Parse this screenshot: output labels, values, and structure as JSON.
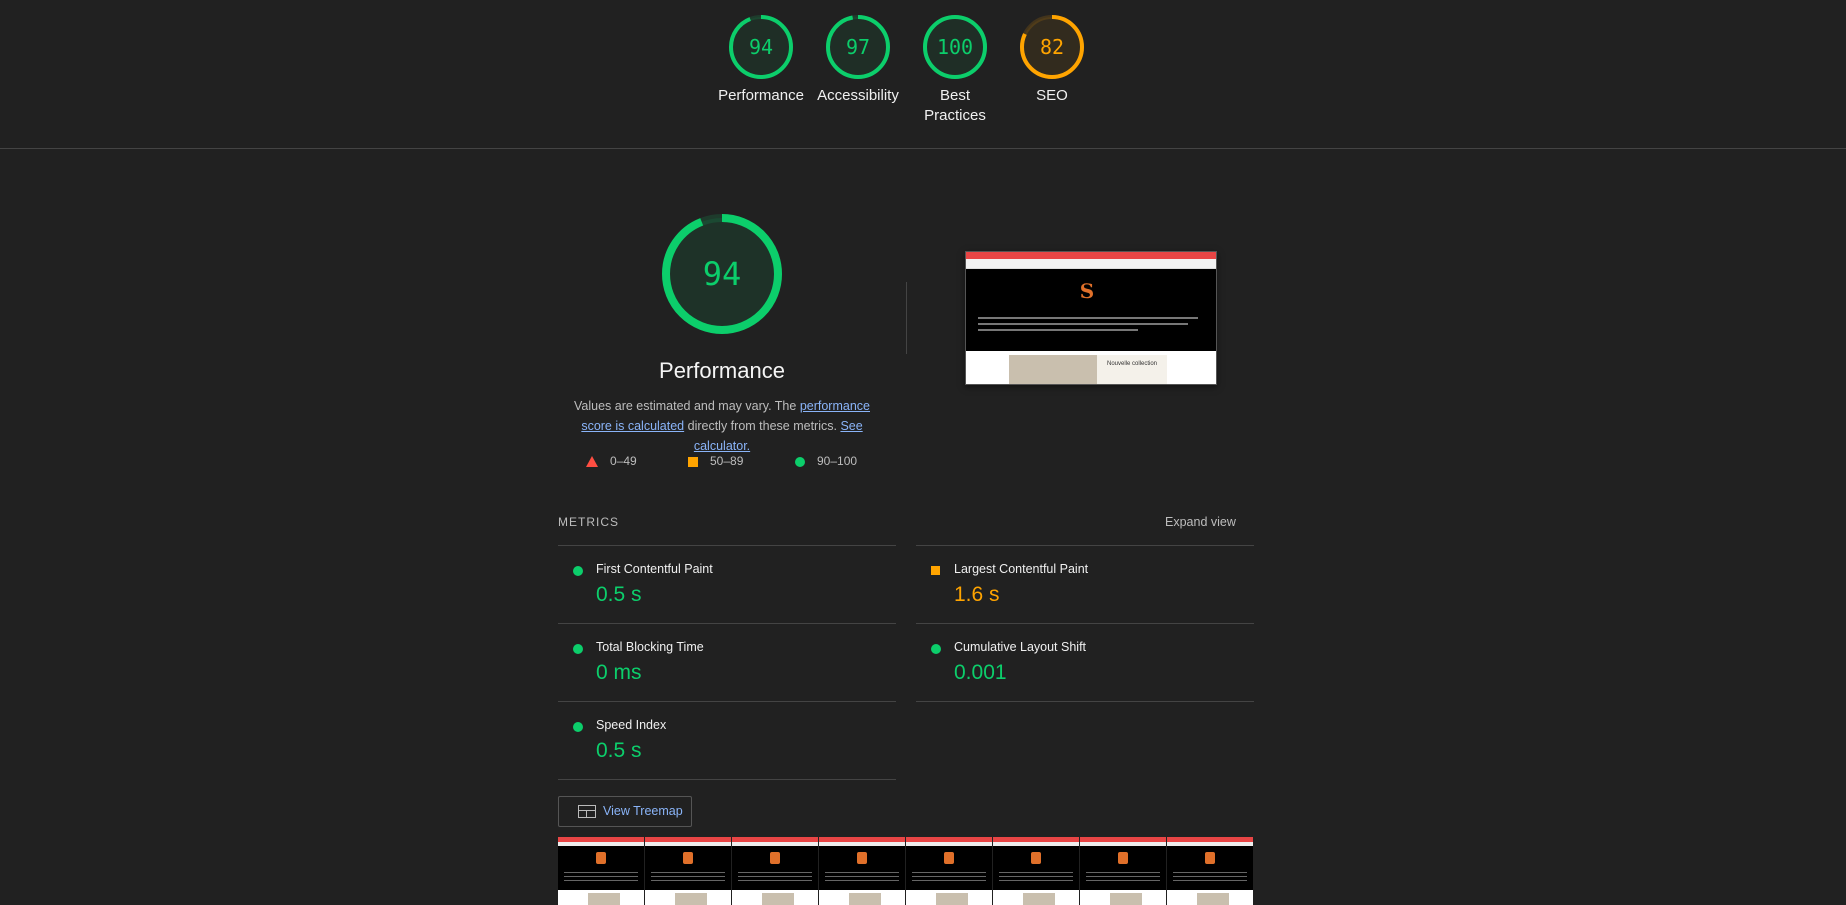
{
  "top_scores": [
    {
      "value": "94",
      "label": "Performance",
      "score": 94,
      "color": "#0cce6b"
    },
    {
      "value": "97",
      "label": "Accessibility",
      "score": 97,
      "color": "#0cce6b"
    },
    {
      "value": "100",
      "label": "Best Practices",
      "score": 100,
      "color": "#0cce6b"
    },
    {
      "value": "82",
      "label": "SEO",
      "score": 82,
      "color": "#ffa400"
    }
  ],
  "performance": {
    "score": "94",
    "score_fraction": 0.94,
    "title": "Performance",
    "desc_prefix": "Values are estimated and may vary. The ",
    "desc_link1": "performance score is calculated",
    "desc_mid": " directly from these metrics. ",
    "desc_link2": "See calculator."
  },
  "legend": [
    {
      "range": "0–49",
      "icon": "triangle-icon",
      "color": "#ff4e42"
    },
    {
      "range": "50–89",
      "icon": "square-icon",
      "color": "#ffa400"
    },
    {
      "range": "90–100",
      "icon": "circle-icon",
      "color": "#0cce6b"
    }
  ],
  "metrics": {
    "heading": "METRICS",
    "expand_label": "Expand view",
    "left": [
      {
        "label": "First Contentful Paint",
        "value": "0.5 s",
        "status": "pass",
        "color": "#0cce6b"
      },
      {
        "label": "Total Blocking Time",
        "value": "0 ms",
        "status": "pass",
        "color": "#0cce6b"
      },
      {
        "label": "Speed Index",
        "value": "0.5 s",
        "status": "pass",
        "color": "#0cce6b"
      }
    ],
    "right": [
      {
        "label": "Largest Contentful Paint",
        "value": "1.6 s",
        "status": "average",
        "color": "#ffa400"
      },
      {
        "label": "Cumulative Layout Shift",
        "value": "0.001",
        "status": "pass",
        "color": "#0cce6b"
      }
    ]
  },
  "treemap": {
    "label": "View Treemap",
    "icon": "treemap-icon"
  },
  "screenshot_thumb": {
    "card_text": "Nouvelle collection"
  },
  "colors": {
    "pass": "#0cce6b",
    "average": "#ffa400",
    "fail": "#ff4e42",
    "link": "#8ab4f8",
    "background": "#212121"
  }
}
